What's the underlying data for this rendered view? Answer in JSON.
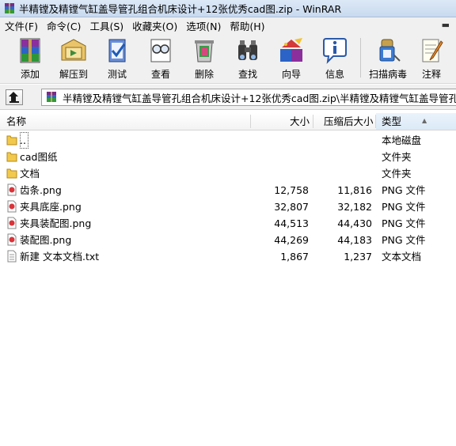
{
  "window": {
    "title": "半精镗及精镗气缸盖导管孔组合机床设计+12张优秀cad图.zip - WinRAR"
  },
  "menu": {
    "items": [
      "文件(F)",
      "命令(C)",
      "工具(S)",
      "收藏夹(O)",
      "选项(N)",
      "帮助(H)"
    ]
  },
  "toolbar": {
    "buttons": [
      {
        "label": "添加",
        "icon": "add-archive-icon"
      },
      {
        "label": "解压到",
        "icon": "extract-to-icon"
      },
      {
        "label": "测试",
        "icon": "test-archive-icon"
      },
      {
        "label": "查看",
        "icon": "view-file-icon"
      },
      {
        "label": "删除",
        "icon": "delete-icon"
      },
      {
        "label": "查找",
        "icon": "find-icon"
      },
      {
        "label": "向导",
        "icon": "wizard-icon"
      },
      {
        "label": "信息",
        "icon": "info-icon"
      },
      {
        "label": "扫描病毒",
        "icon": "virus-scan-icon"
      },
      {
        "label": "注释",
        "icon": "comment-icon"
      }
    ]
  },
  "address": {
    "path": "半精镗及精镗气缸盖导管孔组合机床设计+12张优秀cad图.zip\\半精镗及精镗气缸盖导管孔组合"
  },
  "list": {
    "columns": {
      "name": "名称",
      "size": "大小",
      "packed": "压缩后大小",
      "type": "类型"
    },
    "rows": [
      {
        "name": "..",
        "size": "",
        "packed": "",
        "type": "本地磁盘",
        "icon": "folder-icon"
      },
      {
        "name": "cad图纸",
        "size": "",
        "packed": "",
        "type": "文件夹",
        "icon": "folder-icon"
      },
      {
        "name": "文档",
        "size": "",
        "packed": "",
        "type": "文件夹",
        "icon": "folder-icon"
      },
      {
        "name": "齿条.png",
        "size": "12,758",
        "packed": "11,816",
        "type": "PNG 文件",
        "icon": "png-file-icon"
      },
      {
        "name": "夹具底座.png",
        "size": "32,807",
        "packed": "32,182",
        "type": "PNG 文件",
        "icon": "png-file-icon"
      },
      {
        "name": "夹具装配图.png",
        "size": "44,513",
        "packed": "44,430",
        "type": "PNG 文件",
        "icon": "png-file-icon"
      },
      {
        "name": "装配图.png",
        "size": "44,269",
        "packed": "44,183",
        "type": "PNG 文件",
        "icon": "png-file-icon"
      },
      {
        "name": "新建 文本文档.txt",
        "size": "1,867",
        "packed": "1,237",
        "type": "文本文档",
        "icon": "text-file-icon"
      }
    ]
  }
}
